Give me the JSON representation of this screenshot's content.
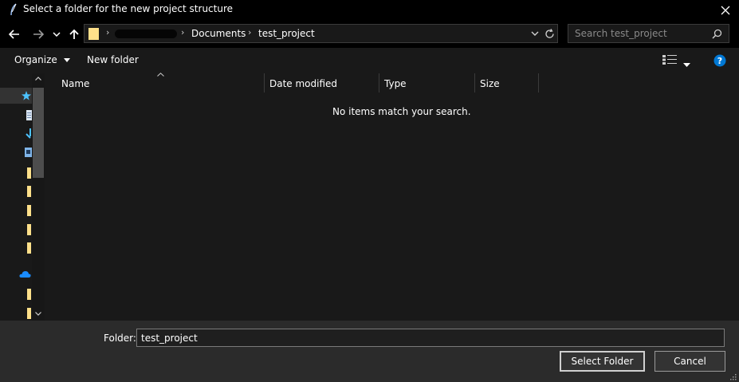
{
  "window": {
    "title": "Select a folder for the new project structure"
  },
  "nav": {
    "crumbs": [
      "Documents",
      "test_project"
    ],
    "search_placeholder": "Search test_project"
  },
  "toolbar": {
    "organize_label": "Organize",
    "new_folder_label": "New folder"
  },
  "columns": {
    "name": "Name",
    "date_modified": "Date modified",
    "type": "Type",
    "size": "Size"
  },
  "file_list": {
    "empty_message": "No items match your search."
  },
  "footer": {
    "folder_label": "Folder:",
    "folder_value": "test_project",
    "select_folder_label": "Select Folder",
    "cancel_label": "Cancel"
  },
  "colors": {
    "accent": "#4cc2ff",
    "help": "#0078d4",
    "folder_yellow": "#ffe08a"
  }
}
